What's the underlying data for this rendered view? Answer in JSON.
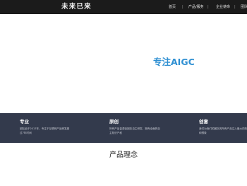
{
  "header": {
    "logo_text": "未来已来",
    "nav": [
      "首页",
      "产品/服务",
      "企业使命",
      "团队"
    ],
    "separator": "|"
  },
  "hero": {
    "title": "专注AIGC"
  },
  "features": [
    {
      "title": "专业",
      "desc": "团队始于2017年，专注于互联网产品研发超过7年时间"
    },
    {
      "title": "原创",
      "desc": "所有产品皆源自团队自主研发，拥有全面的自主知识产权"
    },
    {
      "title": "创意",
      "desc": "我们为我们的团队的所有产品注入最大的热情和想象"
    }
  ],
  "section": {
    "title": "产品理念"
  },
  "colors": {
    "navbar_bg": "#1b1b1b",
    "accent": "#2e8fd2",
    "features_bg": "#333a4c"
  }
}
